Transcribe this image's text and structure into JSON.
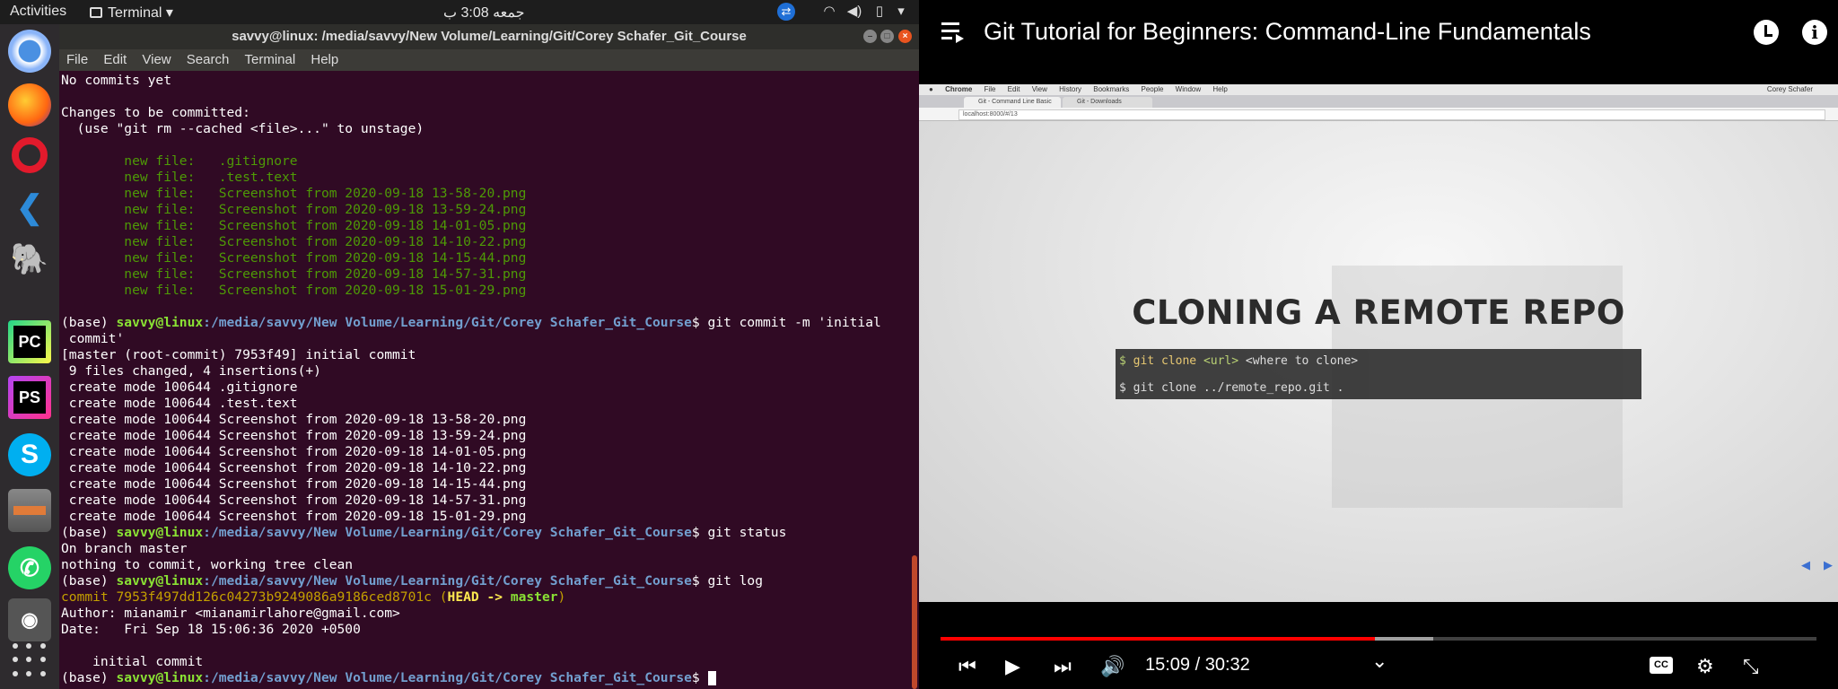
{
  "topbar": {
    "activities": "Activities",
    "app_menu": "Terminal ▾",
    "clock": "جمعه  3:08 ب",
    "tray_icons": [
      "teamviewer-icon",
      "wifi-icon",
      "volume-icon",
      "battery-icon",
      "power-menu-icon"
    ]
  },
  "dock": {
    "apps": [
      "Chromium",
      "Firefox",
      "Opera",
      "Visual Studio Code",
      "pgAdmin",
      "PyCharm",
      "PhpStorm",
      "Skype",
      "Files",
      "WhatsApp",
      "Camera",
      "Show Applications"
    ]
  },
  "terminal": {
    "title": "savvy@linux: /media/savvy/New Volume/Learning/Git/Corey Schafer_Git_Course",
    "menu": [
      "File",
      "Edit",
      "View",
      "Search",
      "Terminal",
      "Help"
    ],
    "prompt": {
      "user": "(base) ",
      "userhost": "savvy@linux",
      "path": ":/media/savvy/New Volume/Learning/Git/Corey Schafer_Git_Course",
      "sign": "$ "
    },
    "lines": {
      "no_commits": "No commits yet",
      "changes": "Changes to be committed:",
      "unstage_hint": "  (use \"git rm --cached <file>...\" to unstage)",
      "new_files": [
        "        new file:   .gitignore",
        "        new file:   .test.text",
        "        new file:   Screenshot from 2020-09-18 13-58-20.png",
        "        new file:   Screenshot from 2020-09-18 13-59-24.png",
        "        new file:   Screenshot from 2020-09-18 14-01-05.png",
        "        new file:   Screenshot from 2020-09-18 14-10-22.png",
        "        new file:   Screenshot from 2020-09-18 14-15-44.png",
        "        new file:   Screenshot from 2020-09-18 14-57-31.png",
        "        new file:   Screenshot from 2020-09-18 15-01-29.png"
      ],
      "cmd_commit": "git commit -m 'initial",
      "cmd_commit_cont": " commit'",
      "commit_result": "[master (root-commit) 7953f49] initial commit",
      "files_changed": " 9 files changed, 4 insertions(+)",
      "create_modes": [
        " create mode 100644 .gitignore",
        " create mode 100644 .test.text",
        " create mode 100644 Screenshot from 2020-09-18 13-58-20.png",
        " create mode 100644 Screenshot from 2020-09-18 13-59-24.png",
        " create mode 100644 Screenshot from 2020-09-18 14-01-05.png",
        " create mode 100644 Screenshot from 2020-09-18 14-10-22.png",
        " create mode 100644 Screenshot from 2020-09-18 14-15-44.png",
        " create mode 100644 Screenshot from 2020-09-18 14-57-31.png",
        " create mode 100644 Screenshot from 2020-09-18 15-01-29.png"
      ],
      "cmd_status": "git status",
      "on_branch": "On branch master",
      "clean": "nothing to commit, working tree clean",
      "cmd_log": "git log",
      "commit_label": "commit 7953f497dd126c04273b9249086a9186ced8701c",
      "head_open": " (",
      "head": "HEAD -> ",
      "branch": "master",
      "head_close": ")",
      "author": "Author: mianamir <mianamirlahore@gmail.com>",
      "date": "Date:   Fri Sep 18 15:06:36 2020 +0500",
      "message": "    initial commit"
    }
  },
  "youtube": {
    "title": "Git Tutorial for Beginners: Command-Line Fundamentals",
    "current_time": "15:09",
    "total_time": "30:32",
    "time_display": "15:09 / 30:32",
    "played_fraction": 0.496,
    "buffered_fraction": 0.562,
    "controls": {
      "previous": "⏮",
      "play": "▶",
      "next": "⏭",
      "volume": "🔊",
      "chevron": "⌄",
      "cc": "CC",
      "settings": "⚙",
      "exit_fullscreen": "⤡"
    },
    "video": {
      "mac_menu": [
        "",
        "Chrome",
        "File",
        "Edit",
        "View",
        "History",
        "Bookmarks",
        "People",
        "Window",
        "Help"
      ],
      "mac_user": "Corey Schafer",
      "tabs": [
        "Git - Command Line Basic",
        "Git - Downloads"
      ],
      "url": "localhost:8000/#/13",
      "slide_heading": "CLONING A REMOTE REPO",
      "code_line1_prompt": "$ ",
      "code_line1_cmd": "git clone ",
      "code_line1_arg": "<url>",
      "code_line1_rest": " <where to clone>",
      "code_line2": "$ git clone ../remote_repo.git ."
    }
  }
}
